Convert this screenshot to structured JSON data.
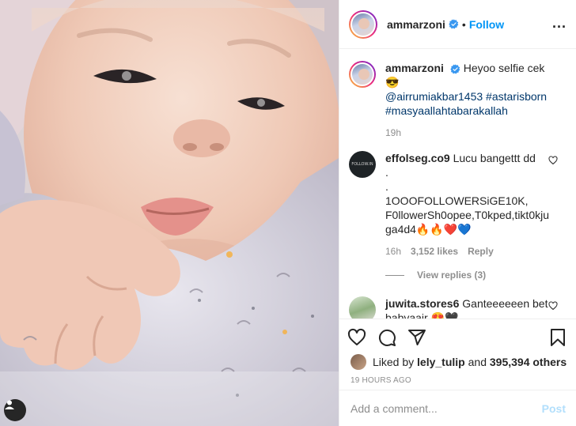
{
  "post": {
    "photo_alt": "baby photo",
    "author": "ammarzoni",
    "follow_label": "Follow",
    "dot_separator": "•",
    "more_label": "..."
  },
  "caption": {
    "author": "ammarzoni",
    "text": "Heyoo selfie cek 😎",
    "mention": "@airrumiakbar1453",
    "tag1": "#astarisborn",
    "tag2": "#masyaallahtabarakallah",
    "time": "19h"
  },
  "comments": [
    {
      "user": "effolseg.co9",
      "text_line1": "Lucu bangettt dd",
      "text_line2": ".",
      "text_line3": ".",
      "text_line4": "1OOOFOLLOWERSiGE10K, F0llowerSh0opee,T0kped,tikt0kju ga4d4🔥🔥❤️💙",
      "time": "16h",
      "likes": "3,152 likes",
      "reply": "Reply",
      "view_replies": "View replies (3)"
    },
    {
      "user": "juwita.stores6",
      "text": "Ganteeeeeen bet babyaair 😍🖤",
      "extra": ".",
      "extra2": "."
    }
  ],
  "likes": {
    "prefix": "Liked by",
    "user": "lely_tulip",
    "connector": "and",
    "count": "395,394 others"
  },
  "timeago": "19 HOURS AGO",
  "add_comment": {
    "placeholder": "Add a comment...",
    "post_label": "Post"
  },
  "colors": {
    "accent": "#0095f6",
    "verified": "#3897f0",
    "muted": "#8e8e8e",
    "post_disabled": "#b2dffc",
    "heart_red": "#ed4956"
  }
}
